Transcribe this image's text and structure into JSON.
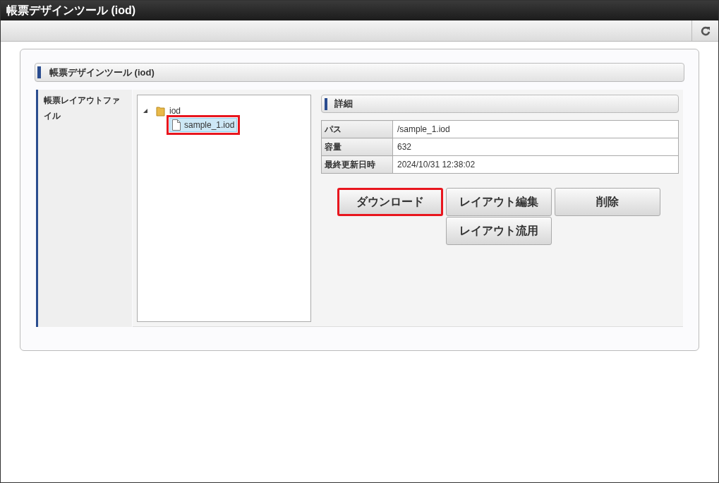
{
  "window": {
    "title": "帳票デザインツール (iod)"
  },
  "section": {
    "title": "帳票デザインツール (iod)"
  },
  "form_label": "帳票レイアウトファイル",
  "tree": [
    {
      "label": "iod",
      "expanded": true,
      "kind": "folder",
      "selected": false,
      "highlighted": false,
      "children": [
        {
          "label": "sample_1.iod",
          "kind": "file",
          "selected": true,
          "highlighted": true
        }
      ]
    }
  ],
  "details": {
    "title": "詳細",
    "rows": [
      {
        "label": "パス",
        "value": "/sample_1.iod"
      },
      {
        "label": "容量",
        "value": "632"
      },
      {
        "label": "最終更新日時",
        "value": "2024/10/31 12:38:02"
      }
    ]
  },
  "buttons": [
    {
      "label": "ダウンロード",
      "highlighted": true
    },
    {
      "label": "レイアウト編集",
      "highlighted": false
    },
    {
      "label": "削除",
      "highlighted": false
    },
    {
      "label": "レイアウト流用",
      "highlighted": false
    }
  ]
}
